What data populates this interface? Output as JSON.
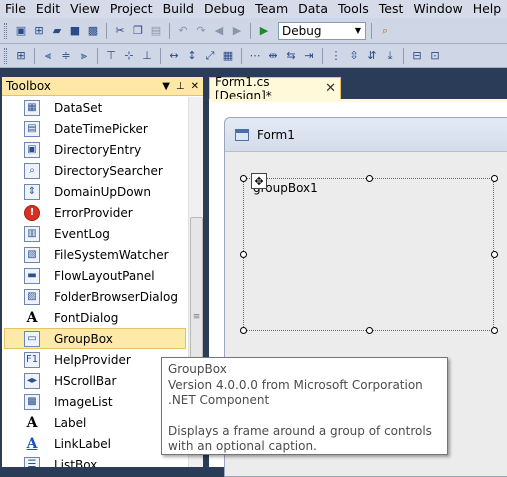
{
  "menu": [
    {
      "label": "File"
    },
    {
      "label": "Edit"
    },
    {
      "label": "View"
    },
    {
      "label": "Project"
    },
    {
      "label": "Build"
    },
    {
      "label": "Debug"
    },
    {
      "label": "Team"
    },
    {
      "label": "Data"
    },
    {
      "label": "Tools"
    },
    {
      "label": "Test"
    },
    {
      "label": "Window"
    },
    {
      "label": "Help"
    }
  ],
  "toolbar": {
    "configuration": "Debug",
    "icons_row1": [
      "new-project-icon",
      "add-item-icon",
      "open-file-icon",
      "save-icon",
      "save-all-icon",
      "cut-icon",
      "copy-icon",
      "paste-icon",
      "undo-icon",
      "redo-icon",
      "navigate-backward-icon",
      "navigate-forward-icon",
      "start-debugging-icon",
      "find-icon"
    ],
    "icons_row2": [
      "align-lefts-icon",
      "align-centers-icon",
      "align-rights-icon",
      "align-tops-icon",
      "align-middles-icon",
      "align-bottoms-icon",
      "make-same-width-icon",
      "make-same-height-icon",
      "make-same-size-icon",
      "size-to-grid-icon",
      "horizontal-spacing-icon",
      "vertical-spacing-icon",
      "center-horizontally-icon",
      "center-vertically-icon",
      "bring-to-front-icon"
    ]
  },
  "toolbox": {
    "title": "Toolbox",
    "items": [
      {
        "label": "DataSet",
        "icon": "dataset-icon",
        "glyph": "▦"
      },
      {
        "label": "DateTimePicker",
        "icon": "datetimepicker-icon",
        "glyph": "▤"
      },
      {
        "label": "DirectoryEntry",
        "icon": "directoryentry-icon",
        "glyph": "▣"
      },
      {
        "label": "DirectorySearcher",
        "icon": "directorysearcher-icon",
        "glyph": "⌕"
      },
      {
        "label": "DomainUpDown",
        "icon": "domainupdown-icon",
        "glyph": "⇕"
      },
      {
        "label": "ErrorProvider",
        "icon": "errorprovider-icon",
        "glyph": "!"
      },
      {
        "label": "EventLog",
        "icon": "eventlog-icon",
        "glyph": "▥"
      },
      {
        "label": "FileSystemWatcher",
        "icon": "filesystemwatcher-icon",
        "glyph": "▧"
      },
      {
        "label": "FlowLayoutPanel",
        "icon": "flowlayoutpanel-icon",
        "glyph": "▬"
      },
      {
        "label": "FolderBrowserDialog",
        "icon": "folderbrowserdialog-icon",
        "glyph": "▨"
      },
      {
        "label": "FontDialog",
        "icon": "fontdialog-icon",
        "glyph": "A"
      },
      {
        "label": "GroupBox",
        "icon": "groupbox-icon",
        "glyph": "▭"
      },
      {
        "label": "HelpProvider",
        "icon": "helpprovider-icon",
        "glyph": "F1"
      },
      {
        "label": "HScrollBar",
        "icon": "hscrollbar-icon",
        "glyph": "◂▸"
      },
      {
        "label": "ImageList",
        "icon": "imagelist-icon",
        "glyph": "▩"
      },
      {
        "label": "Label",
        "icon": "label-icon",
        "glyph": "A"
      },
      {
        "label": "LinkLabel",
        "icon": "linklabel-icon",
        "glyph": "A"
      },
      {
        "label": "ListBox",
        "icon": "listbox-icon",
        "glyph": "☰"
      }
    ],
    "selected_index": 11
  },
  "document": {
    "tab_label": "Form1.cs [Design]*",
    "form_title": "Form1",
    "groupbox_label": "groupBox1"
  },
  "tooltip": {
    "title": "GroupBox",
    "version": "Version 4.0.0.0 from Microsoft Corporation",
    "kind": ".NET Component",
    "description": "Displays a frame around a group of controls with an optional caption."
  },
  "colors": {
    "selection": "#fde9a8",
    "ide_background": "#2b3c59",
    "toolbar": "#cfd6e5"
  }
}
